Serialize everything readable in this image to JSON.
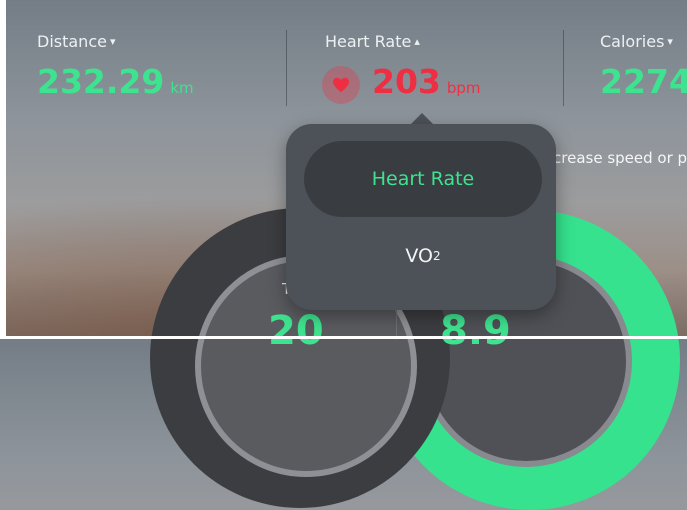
{
  "metrics": {
    "distance": {
      "label": "Distance",
      "caret": "▾",
      "value": "232.29",
      "unit": "km"
    },
    "heart_rate": {
      "label": "Heart Rate",
      "caret": "▴",
      "value": "203",
      "unit": "bpm"
    },
    "calories": {
      "label": "Calories",
      "caret": "▾",
      "value": "2274"
    }
  },
  "hint": "crease speed or p",
  "gauges": {
    "left_label_partial": "Ti",
    "left_value": "20",
    "right_value": "8.9"
  },
  "dropdown": {
    "options": [
      {
        "label": "Heart Rate",
        "selected": true
      },
      {
        "label": "VO",
        "subscript": "2",
        "selected": false
      }
    ]
  },
  "colors": {
    "accent_green": "#3ee38f",
    "heart_red": "#ee2f43",
    "popup_bg": "#4c5258"
  }
}
